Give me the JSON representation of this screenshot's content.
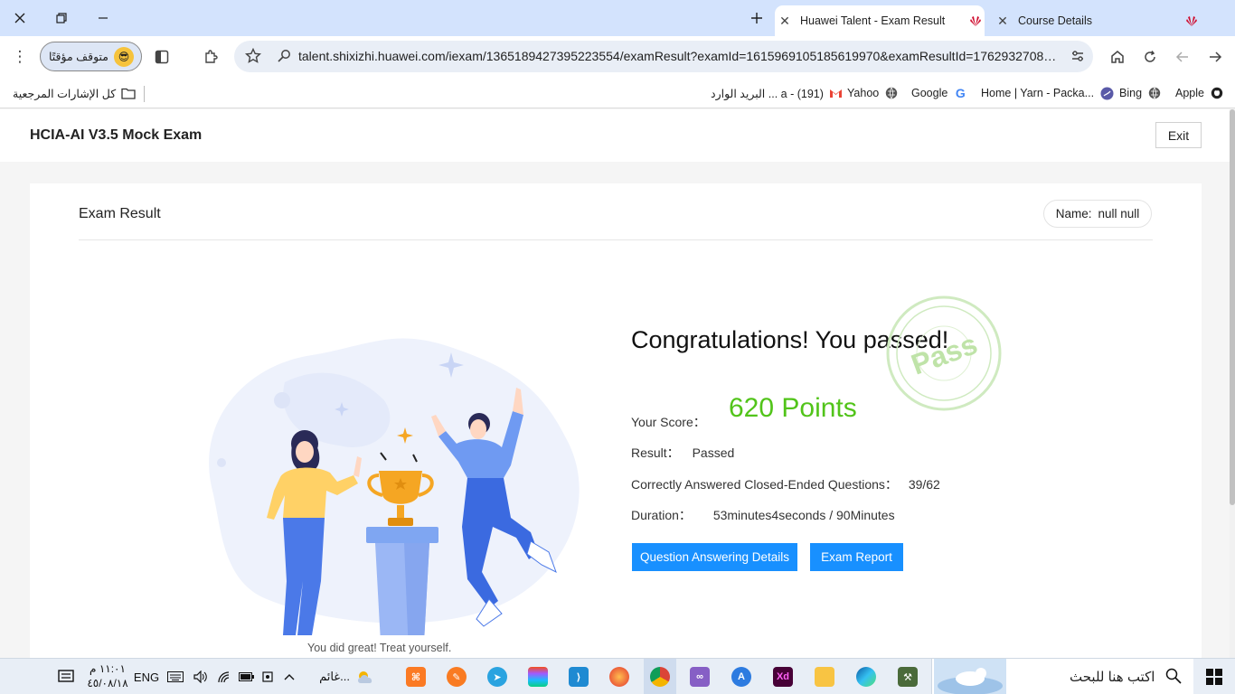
{
  "browser": {
    "tabs": [
      {
        "title": "Huawei Talent - Exam Result",
        "active": true
      },
      {
        "title": "Course Details",
        "active": false
      }
    ],
    "profile_label": "متوقف مؤقتًا",
    "url": "talent.shixizhi.huawei.com/iexam/1365189427395223554/examResult?examId=1615969105185619970&examResultId=1762932708500...",
    "bookmarks": {
      "all_bookmarks": "كل الإشارات المرجعية",
      "items": [
        "Apple",
        "Bing",
        "Home | Yarn - Packa...",
        "Google",
        "Yahoo",
        "البريد الوارد ... a - (191)"
      ]
    }
  },
  "page": {
    "title": "HCIA-AI V3.5 Mock Exam",
    "exit_label": "Exit",
    "card_title": "Exam Result",
    "name_label": "Name:",
    "name_value": "null null",
    "congrats": "Congratulations! You passed!",
    "stamp_text": "Pass",
    "score_label": "Your Score：",
    "score_value": "620 Points",
    "result_label": "Result：",
    "result_value": "Passed",
    "correct_label": "Correctly Answered Closed-Ended Questions：",
    "correct_value": "39/62",
    "duration_label": "Duration：",
    "duration_value": "53minutes4seconds / 90Minutes",
    "details_button": "Question Answering Details",
    "report_button": "Exam Report",
    "treat_text": "You did great! Treat yourself.",
    "accent_color": "#1890ff",
    "score_color": "#52c41a"
  },
  "taskbar": {
    "search_placeholder": "اكتب هنا للبحث",
    "weather": "غائم...",
    "lang": "ENG",
    "time": "١١:٠١ م",
    "date": "٤٥/٠٨/١٨"
  }
}
